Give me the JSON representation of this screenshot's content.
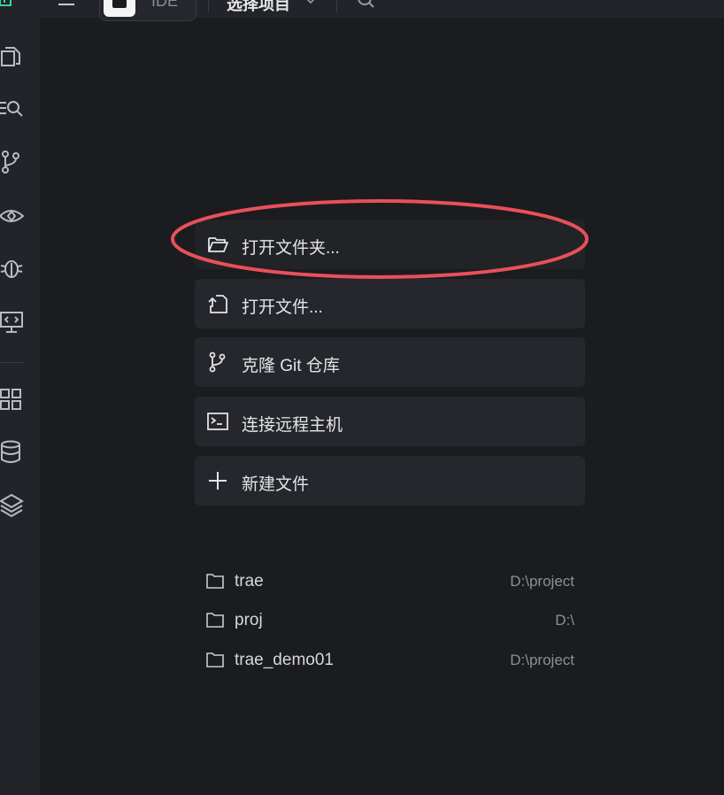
{
  "topbar": {
    "ide_label": "IDE",
    "project_select_label": "选择项目"
  },
  "sidebar": {
    "icons": [
      "files-icon",
      "search-replace-icon",
      "source-control-icon",
      "preview-icon",
      "debug-icon",
      "remote-explorer-icon",
      "extensions-icon",
      "database-icon",
      "layers-icon"
    ]
  },
  "actions": [
    {
      "label": "打开文件夹...",
      "icon": "folder-open-icon"
    },
    {
      "label": "打开文件...",
      "icon": "file-open-icon"
    },
    {
      "label": "克隆 Git 仓库",
      "icon": "git-branch-icon"
    },
    {
      "label": "连接远程主机",
      "icon": "terminal-icon"
    },
    {
      "label": "新建文件",
      "icon": "plus-icon"
    }
  ],
  "recent_projects": [
    {
      "name": "trae",
      "path": "D:\\project"
    },
    {
      "name": "proj",
      "path": "D:\\"
    },
    {
      "name": "trae_demo01",
      "path": "D:\\project"
    }
  ],
  "colors": {
    "background": "#1b1c1f",
    "panel": "#26272c",
    "highlight_ellipse": "#e8505b",
    "brand_green": "#34d399"
  }
}
